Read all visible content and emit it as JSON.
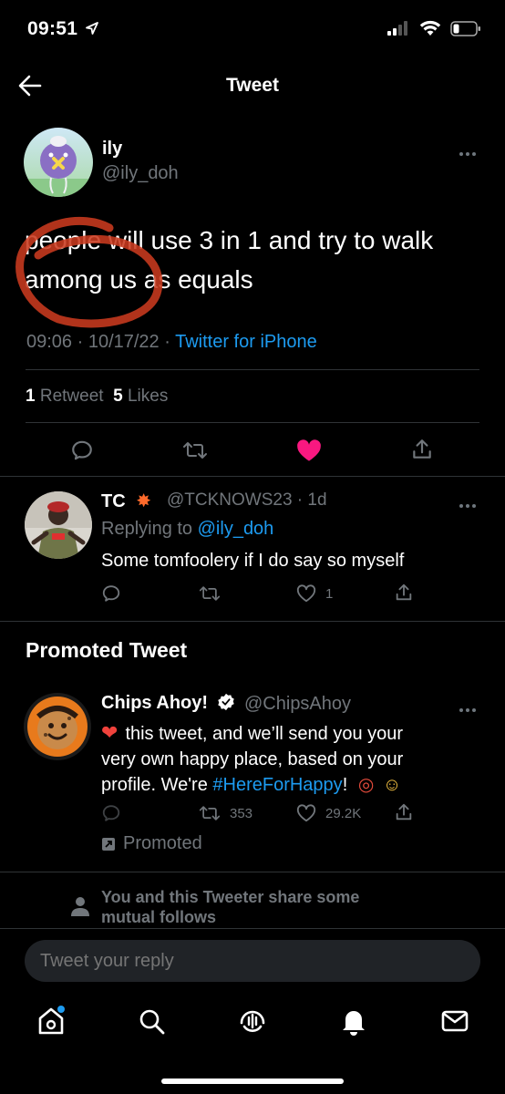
{
  "status": {
    "time": "09:51"
  },
  "nav": {
    "title": "Tweet"
  },
  "main_tweet": {
    "name": "ily",
    "handle": "@ily_doh",
    "text_line1": "people will use 3 in 1 and try to walk",
    "text_line2": "among us as equals",
    "time": "09:06 · 10/17/22 · ",
    "source": "Twitter for iPhone",
    "retweets_count": "1",
    "retweets_label": "Retweet",
    "likes_count": "5",
    "likes_label": "Likes"
  },
  "reply": {
    "name": "TC",
    "handle": "@TCKNOWS23",
    "age": "1d",
    "replying_prefix": "Replying to ",
    "replying_to": "@ily_doh",
    "text": "Some tomfoolery if I do say so myself",
    "likes": "1"
  },
  "promoted_section": {
    "heading": "Promoted Tweet"
  },
  "promoted": {
    "name": "Chips Ahoy!",
    "handle": "@ChipsAhoy",
    "line1": "this tweet, and we’ll send you your",
    "line2": "very own happy place, based on your",
    "line3_prefix": "profile. We're ",
    "hashtag": "#HereForHappy",
    "line3_suffix": "!",
    "retweets": "353",
    "likes": "29.2K",
    "promoted_label": "Promoted"
  },
  "mutual": {
    "line1": "You and this Tweeter share some",
    "line2": "mutual follows"
  },
  "reply_bar": {
    "placeholder": "Tweet your reply"
  },
  "colors": {
    "accent": "#1d9bf0",
    "like": "#f91880",
    "muted": "#71767b",
    "background": "#000000"
  },
  "icons": [
    "back-arrow-icon",
    "more-dots-icon",
    "reply-icon",
    "retweet-icon",
    "heart-icon",
    "share-icon",
    "verified-icon",
    "home-icon",
    "search-icon",
    "spaces-icon",
    "bell-icon",
    "mail-icon"
  ]
}
